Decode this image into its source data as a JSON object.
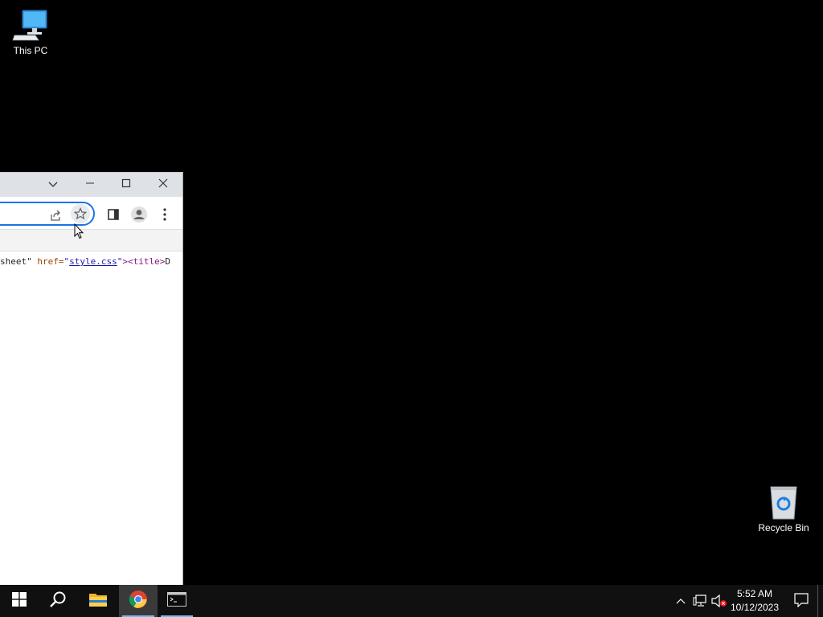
{
  "desktop": {
    "icons": [
      {
        "label": "This PC",
        "icon": "computer-icon"
      },
      {
        "label": "Recycle Bin",
        "icon": "recycle-bin-icon"
      }
    ]
  },
  "browser": {
    "icons": [
      "chevron-down-icon",
      "minimize-icon",
      "maximize-icon",
      "close-icon",
      "share-icon",
      "star-icon",
      "side-panel-icon",
      "profile-icon",
      "menu-icon"
    ],
    "source_line": {
      "part1": "sheet\"",
      "attr": " href=",
      "q1": "\"",
      "link": "style.css",
      "q2": "\"",
      "close": ">",
      "tag": "<title>",
      "tail": "D"
    }
  },
  "taskbar": {
    "apps": [
      "start-icon",
      "search-icon",
      "file-explorer-icon",
      "chrome-icon",
      "terminal-icon"
    ],
    "time": "5:52 AM",
    "date": "10/12/2023",
    "tray": [
      "chevron-up-icon",
      "network-icon",
      "volume-muted-icon",
      "notification-icon"
    ],
    "accent": "#76b9ed"
  }
}
